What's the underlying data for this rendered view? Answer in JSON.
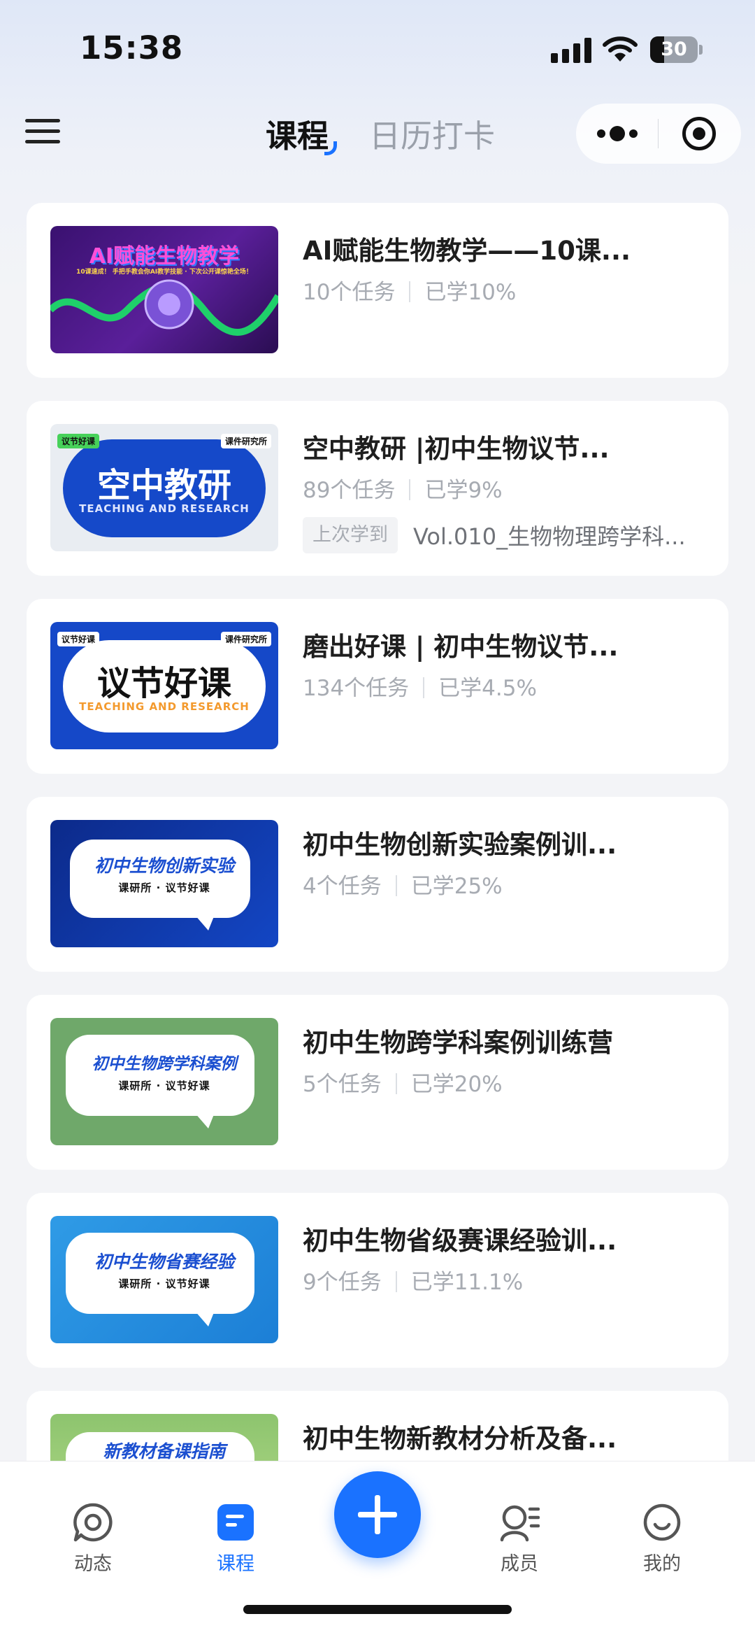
{
  "status_bar": {
    "time": "15:38",
    "battery": "30",
    "battery_level": 0.3
  },
  "header": {
    "tab_courses": "课程",
    "tab_calendar": "日历打卡"
  },
  "courses": [
    {
      "title": "AI赋能生物教学——10课...",
      "tasks": "10个任务",
      "progress": "已学10%",
      "thumb": {
        "title": "AI赋能生物教学",
        "subtitle": "10课速成！ 手把手教会你AI教学技能 · 下次公开课惊艳全场！",
        "tags": []
      }
    },
    {
      "title": "空中教研 |初中生物议节...",
      "tasks": "89个任务",
      "progress": "已学9%",
      "last_label": "上次学到",
      "last_lesson": "Vol.010_生物物理跨学科...",
      "thumb": {
        "title": "空中教研",
        "subtitle": "TEACHING AND RESEARCH",
        "tags": [
          "议节好课",
          "课件研究所"
        ]
      }
    },
    {
      "title": "磨出好课 | 初中生物议节...",
      "tasks": "134个任务",
      "progress": "已学4.5%",
      "thumb": {
        "title": "议节好课",
        "subtitle": "TEACHING AND RESEARCH",
        "tags": [
          "议节好课",
          "课件研究所"
        ]
      }
    },
    {
      "title": "初中生物创新实验案例训...",
      "tasks": "4个任务",
      "progress": "已学25%",
      "thumb": {
        "title": "初中生物创新实验",
        "subtitle": "课研所 · 议节好课",
        "tags": []
      }
    },
    {
      "title": "初中生物跨学科案例训练营",
      "tasks": "5个任务",
      "progress": "已学20%",
      "thumb": {
        "title": "初中生物跨学科案例",
        "subtitle": "课研所 · 议节好课",
        "tags": []
      }
    },
    {
      "title": "初中生物省级赛课经验训...",
      "tasks": "9个任务",
      "progress": "已学11.1%",
      "thumb": {
        "title": "初中生物省赛经验",
        "subtitle": "课研所 · 议节好课",
        "tags": []
      }
    },
    {
      "title": "初中生物新教材分析及备...",
      "tasks": "",
      "progress": "",
      "thumb": {
        "title": "新教材备课指南",
        "subtitle": "",
        "tags": []
      }
    }
  ],
  "tabbar": {
    "feed": "动态",
    "courses": "课程",
    "members": "成员",
    "me": "我的",
    "active": "courses",
    "accent": "#1a72ff"
  },
  "icons": [
    "menu-icon",
    "more-icon",
    "target-icon",
    "chat-bubble-icon",
    "course-doc-icon",
    "plus-icon",
    "member-icon",
    "smile-icon"
  ]
}
